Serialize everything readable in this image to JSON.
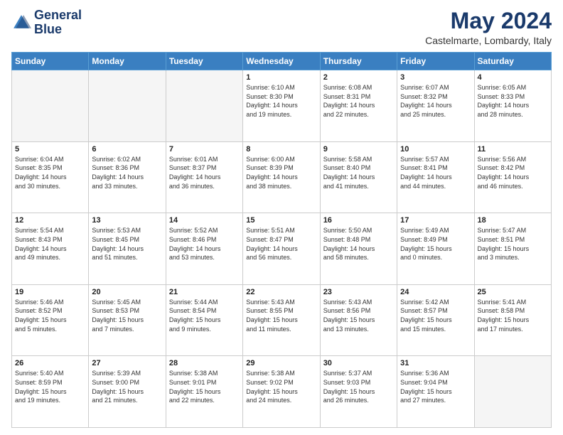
{
  "header": {
    "logo_line1": "General",
    "logo_line2": "Blue",
    "month_year": "May 2024",
    "location": "Castelmarte, Lombardy, Italy"
  },
  "weekdays": [
    "Sunday",
    "Monday",
    "Tuesday",
    "Wednesday",
    "Thursday",
    "Friday",
    "Saturday"
  ],
  "weeks": [
    [
      {
        "day": "",
        "info": ""
      },
      {
        "day": "",
        "info": ""
      },
      {
        "day": "",
        "info": ""
      },
      {
        "day": "1",
        "info": "Sunrise: 6:10 AM\nSunset: 8:30 PM\nDaylight: 14 hours\nand 19 minutes."
      },
      {
        "day": "2",
        "info": "Sunrise: 6:08 AM\nSunset: 8:31 PM\nDaylight: 14 hours\nand 22 minutes."
      },
      {
        "day": "3",
        "info": "Sunrise: 6:07 AM\nSunset: 8:32 PM\nDaylight: 14 hours\nand 25 minutes."
      },
      {
        "day": "4",
        "info": "Sunrise: 6:05 AM\nSunset: 8:33 PM\nDaylight: 14 hours\nand 28 minutes."
      }
    ],
    [
      {
        "day": "5",
        "info": "Sunrise: 6:04 AM\nSunset: 8:35 PM\nDaylight: 14 hours\nand 30 minutes."
      },
      {
        "day": "6",
        "info": "Sunrise: 6:02 AM\nSunset: 8:36 PM\nDaylight: 14 hours\nand 33 minutes."
      },
      {
        "day": "7",
        "info": "Sunrise: 6:01 AM\nSunset: 8:37 PM\nDaylight: 14 hours\nand 36 minutes."
      },
      {
        "day": "8",
        "info": "Sunrise: 6:00 AM\nSunset: 8:39 PM\nDaylight: 14 hours\nand 38 minutes."
      },
      {
        "day": "9",
        "info": "Sunrise: 5:58 AM\nSunset: 8:40 PM\nDaylight: 14 hours\nand 41 minutes."
      },
      {
        "day": "10",
        "info": "Sunrise: 5:57 AM\nSunset: 8:41 PM\nDaylight: 14 hours\nand 44 minutes."
      },
      {
        "day": "11",
        "info": "Sunrise: 5:56 AM\nSunset: 8:42 PM\nDaylight: 14 hours\nand 46 minutes."
      }
    ],
    [
      {
        "day": "12",
        "info": "Sunrise: 5:54 AM\nSunset: 8:43 PM\nDaylight: 14 hours\nand 49 minutes."
      },
      {
        "day": "13",
        "info": "Sunrise: 5:53 AM\nSunset: 8:45 PM\nDaylight: 14 hours\nand 51 minutes."
      },
      {
        "day": "14",
        "info": "Sunrise: 5:52 AM\nSunset: 8:46 PM\nDaylight: 14 hours\nand 53 minutes."
      },
      {
        "day": "15",
        "info": "Sunrise: 5:51 AM\nSunset: 8:47 PM\nDaylight: 14 hours\nand 56 minutes."
      },
      {
        "day": "16",
        "info": "Sunrise: 5:50 AM\nSunset: 8:48 PM\nDaylight: 14 hours\nand 58 minutes."
      },
      {
        "day": "17",
        "info": "Sunrise: 5:49 AM\nSunset: 8:49 PM\nDaylight: 15 hours\nand 0 minutes."
      },
      {
        "day": "18",
        "info": "Sunrise: 5:47 AM\nSunset: 8:51 PM\nDaylight: 15 hours\nand 3 minutes."
      }
    ],
    [
      {
        "day": "19",
        "info": "Sunrise: 5:46 AM\nSunset: 8:52 PM\nDaylight: 15 hours\nand 5 minutes."
      },
      {
        "day": "20",
        "info": "Sunrise: 5:45 AM\nSunset: 8:53 PM\nDaylight: 15 hours\nand 7 minutes."
      },
      {
        "day": "21",
        "info": "Sunrise: 5:44 AM\nSunset: 8:54 PM\nDaylight: 15 hours\nand 9 minutes."
      },
      {
        "day": "22",
        "info": "Sunrise: 5:43 AM\nSunset: 8:55 PM\nDaylight: 15 hours\nand 11 minutes."
      },
      {
        "day": "23",
        "info": "Sunrise: 5:43 AM\nSunset: 8:56 PM\nDaylight: 15 hours\nand 13 minutes."
      },
      {
        "day": "24",
        "info": "Sunrise: 5:42 AM\nSunset: 8:57 PM\nDaylight: 15 hours\nand 15 minutes."
      },
      {
        "day": "25",
        "info": "Sunrise: 5:41 AM\nSunset: 8:58 PM\nDaylight: 15 hours\nand 17 minutes."
      }
    ],
    [
      {
        "day": "26",
        "info": "Sunrise: 5:40 AM\nSunset: 8:59 PM\nDaylight: 15 hours\nand 19 minutes."
      },
      {
        "day": "27",
        "info": "Sunrise: 5:39 AM\nSunset: 9:00 PM\nDaylight: 15 hours\nand 21 minutes."
      },
      {
        "day": "28",
        "info": "Sunrise: 5:38 AM\nSunset: 9:01 PM\nDaylight: 15 hours\nand 22 minutes."
      },
      {
        "day": "29",
        "info": "Sunrise: 5:38 AM\nSunset: 9:02 PM\nDaylight: 15 hours\nand 24 minutes."
      },
      {
        "day": "30",
        "info": "Sunrise: 5:37 AM\nSunset: 9:03 PM\nDaylight: 15 hours\nand 26 minutes."
      },
      {
        "day": "31",
        "info": "Sunrise: 5:36 AM\nSunset: 9:04 PM\nDaylight: 15 hours\nand 27 minutes."
      },
      {
        "day": "",
        "info": ""
      }
    ]
  ]
}
